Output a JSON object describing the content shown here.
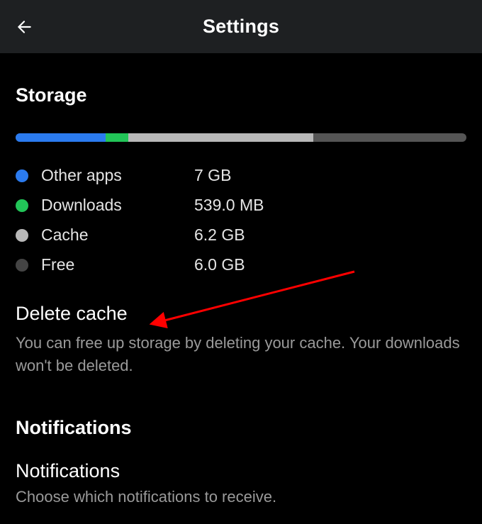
{
  "header": {
    "title": "Settings"
  },
  "storage": {
    "heading": "Storage",
    "bar": {
      "other_apps_pct": 20,
      "downloads_pct": 5,
      "cache_pct": 41,
      "free_pct": 34
    },
    "legend": {
      "other_apps_label": "Other apps",
      "other_apps_value": "7 GB",
      "downloads_label": "Downloads",
      "downloads_value": "539.0 MB",
      "cache_label": "Cache",
      "cache_value": "6.2 GB",
      "free_label": "Free",
      "free_value": "6.0 GB"
    },
    "delete_cache": {
      "title": "Delete cache",
      "description": "You can free up storage by deleting your cache. Your downloads won't be deleted."
    }
  },
  "notifications": {
    "heading": "Notifications",
    "item_title": "Notifications",
    "item_description": "Choose which notifications to receive."
  },
  "colors": {
    "other_apps": "#2b7bef",
    "downloads": "#22c558",
    "cache": "#b8b8b8",
    "free": "#555555",
    "arrow": "#ff0000"
  }
}
